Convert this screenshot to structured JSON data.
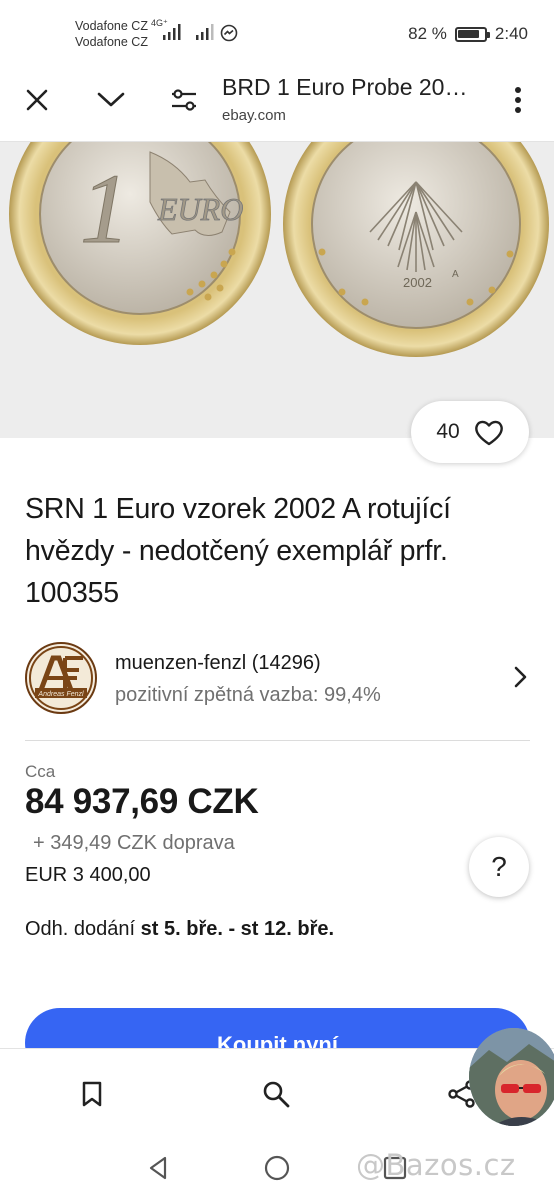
{
  "status_bar": {
    "carrier_1": "Vodafone CZ",
    "network_type": "4G⁺",
    "carrier_2": "Vodafone CZ",
    "battery_percent": "82 %",
    "battery_level": 0.82,
    "time": "2:40"
  },
  "browser": {
    "page_title": "BRD 1 Euro Probe 20…",
    "host": "ebay.com"
  },
  "hero": {
    "coin_value": "1",
    "coin_word": "EURO",
    "coin_year": "2002",
    "mint_mark": "A",
    "watchers": "40"
  },
  "listing": {
    "title": "SRN 1 Euro vzorek 2002 A rotující hvězdy - nedotčený exemplář prfr. 100355"
  },
  "seller": {
    "name": "muenzen-fenzl (14296)",
    "feedback": "pozitivní zpětná vazba: 99,4%",
    "logo_text": "Andreas Fenzl"
  },
  "pricing": {
    "approx_label": "Cca",
    "price": "84 937,69 CZK",
    "shipping": "+ 349,49 CZK doprava",
    "original_price": "EUR 3 400,00",
    "help_label": "?"
  },
  "delivery": {
    "label": "Odh. dodání",
    "range": "st 5. bře. - st 12. bře."
  },
  "buy_button": {
    "label": "Koupit nyní"
  },
  "watermark": "@Bazos.cz",
  "colors": {
    "accent": "#3665f3",
    "text": "#191919",
    "secondary_text": "#707070"
  }
}
